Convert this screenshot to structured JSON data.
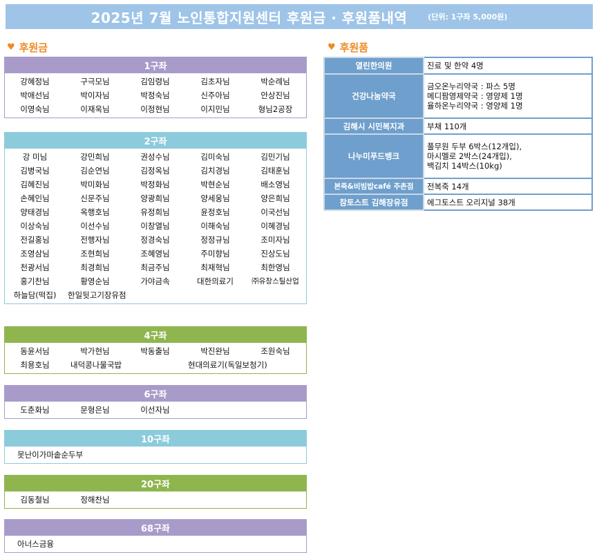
{
  "banner": {
    "title": "2025년 7월 노인통합지원센터 후원금 · 후원품내역",
    "unit": "(단위: 1구좌 5,000원)"
  },
  "donations": {
    "heading": "후원금",
    "groups": [
      {
        "label": "1구좌",
        "color": "#a99bc9",
        "names": [
          "강혜정님",
          "구극모님",
          "김임령님",
          "김초자님",
          "박순례님",
          "박애선님",
          "박이자님",
          "박정숙님",
          "신주아님",
          "안상진님",
          "이영숙님",
          "이재욱님",
          "이정현님",
          "이지민님",
          "형님2공장"
        ]
      },
      {
        "label": "2구좌",
        "color": "#8ccbdc",
        "names": [
          "강 미님",
          "강민희님",
          "권성수님",
          "김미숙님",
          "김민기님",
          "김병국님",
          "김순연님",
          "김정옥님",
          "김치경님",
          "김태훈님",
          "김혜진님",
          "박미화님",
          "박정화님",
          "박현순님",
          "배소영님",
          "손혜인님",
          "신문주님",
          "양광희님",
          "양세웅님",
          "양은희님",
          "양태경님",
          "옥행호님",
          "유정희님",
          "윤정호님",
          "이국선님",
          "이상숙님",
          "이선수님",
          "이창열님",
          "이해숙님",
          "이혜경님",
          "전길홍님",
          "전행자님",
          "정경숙님",
          "정정규님",
          "조미자님",
          "조영삼님",
          "조현희님",
          "조혜영님",
          "주미향님",
          "진상도님",
          "천광서님",
          "최경희님",
          "최금주님",
          "최재혁님",
          "최한영님",
          "홍기찬님",
          "황영순님",
          "가야금속",
          "대한의료기",
          "㈜유창스틸산업",
          "하늘담(떡집)",
          "한일뒷고기장유점"
        ]
      },
      {
        "label": "4구좌",
        "color": "#8fb54f",
        "names": [
          "동윤서님",
          "박가현님",
          "박동출님",
          "박진완님",
          "조원숙님",
          "최용호님",
          "내덕콩나물국밥",
          "현대의료기(독일보청기)"
        ]
      },
      {
        "label": "6구좌",
        "color": "#a99bc9",
        "names": [
          "도춘화님",
          "문형은님",
          "이선자님"
        ]
      },
      {
        "label": "10구좌",
        "color": "#8ccbdc",
        "names": [
          "못난이가마솥순두부"
        ]
      },
      {
        "label": "20구좌",
        "color": "#8fb54f",
        "names": [
          "김동철님",
          "정해찬님"
        ]
      },
      {
        "label": "68구좌",
        "color": "#a99bc9",
        "names": [
          "아너스금융"
        ]
      }
    ]
  },
  "goods": {
    "heading": "후원품",
    "rows": [
      {
        "source": "열린한의원",
        "items": [
          "진료 및 한약 4명"
        ]
      },
      {
        "source": "건강나눔약국",
        "items": [
          "금오온누리약국 : 파스 5명",
          "메디팜영제약국 : 영양제 1명",
          "율하온누리약국 : 영양제 1명"
        ]
      },
      {
        "source": "김해시 시민복지과",
        "items": [
          "부채 110개"
        ]
      },
      {
        "source": "나누미푸드뱅크",
        "items": [
          "풀무원 두부 6박스(12개입),",
          "마시멜로 2박스(24개입),",
          "백김치 14박스(10kg)"
        ]
      },
      {
        "source": "본죽&비빔밥café 주촌점",
        "items": [
          "전복죽 14개"
        ]
      },
      {
        "source": "참토스트 김해장유점",
        "items": [
          "에그토스트 오리지널 38개"
        ]
      }
    ]
  },
  "colors": {
    "banner": "#9ec4e8",
    "heading": "#f08a24",
    "goods_source": "#6f9fcc"
  }
}
